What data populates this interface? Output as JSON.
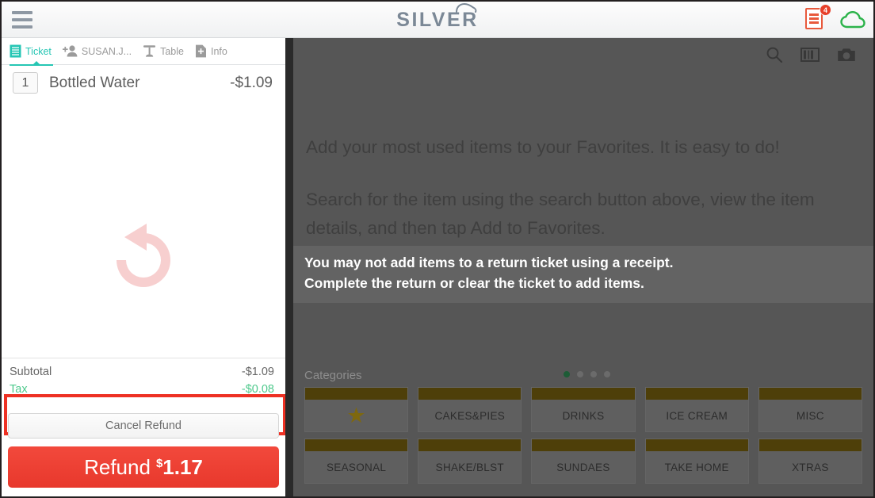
{
  "header": {
    "menu_icon": "hamburger-icon",
    "brand": "SILVER",
    "brand_mark_icon": "cloud-outline-icon",
    "offline_receipts_icon": "receipt-icon",
    "offline_receipts_badge": "4",
    "cloud_icon": "cloud-icon",
    "colors": {
      "brand_text": "#7b8896",
      "receipt": "#e8593c",
      "badge": "#e8402a",
      "cloud": "#2cb34a"
    }
  },
  "ticket_panel": {
    "tabs": [
      {
        "label": "Ticket",
        "icon": "receipt-lines-icon",
        "active": true
      },
      {
        "label": "SUSAN.J...",
        "icon": "add-person-icon",
        "active": false
      },
      {
        "label": "Table",
        "icon": "table-icon",
        "active": false
      },
      {
        "label": "Info",
        "icon": "note-add-icon",
        "active": false
      }
    ],
    "items": [
      {
        "qty": "1",
        "name": "Bottled Water",
        "price": "-$1.09"
      }
    ],
    "watermark_icon": "return-undo-arrow-icon",
    "totals": [
      {
        "label": "Subtotal",
        "value": "-$1.09",
        "style": "normal"
      },
      {
        "label": "Tax",
        "value": "-$0.08",
        "style": "credit"
      }
    ],
    "cancel_label": "Cancel Refund",
    "refund": {
      "label": "Refund",
      "currency": "$",
      "amount": "1.17"
    },
    "annotation_color": "#ee3124",
    "accent_color": "#26c6b4",
    "refund_color": "#e8382c",
    "tax_color": "#4ec98c"
  },
  "catalog_panel": {
    "toolbar": [
      {
        "icon": "search-icon"
      },
      {
        "icon": "barcode-icon"
      },
      {
        "icon": "camera-icon"
      }
    ],
    "favorites_help": [
      "Add your most used items to your Favorites. It is easy to do!",
      "Search for the item using the search button above, view the item details, and then tap Add to Favorites."
    ],
    "toast": [
      "You may not add items to a return ticket using a receipt.",
      "Complete the return or clear the ticket to add items."
    ],
    "categories_title": "Categories",
    "page_dots": {
      "count": 4,
      "active_index": 0,
      "active_color": "#1d5c36"
    },
    "categories": [
      {
        "label": "",
        "icon": "star-icon"
      },
      {
        "label": "CAKES&PIES",
        "icon": ""
      },
      {
        "label": "DRINKS",
        "icon": ""
      },
      {
        "label": "ICE CREAM",
        "icon": ""
      },
      {
        "label": "MISC",
        "icon": ""
      },
      {
        "label": "SEASONAL",
        "icon": ""
      },
      {
        "label": "SHAKE/BLST",
        "icon": ""
      },
      {
        "label": "SUNDAES",
        "icon": ""
      },
      {
        "label": "TAKE HOME",
        "icon": ""
      },
      {
        "label": "XTRAS",
        "icon": ""
      }
    ]
  }
}
